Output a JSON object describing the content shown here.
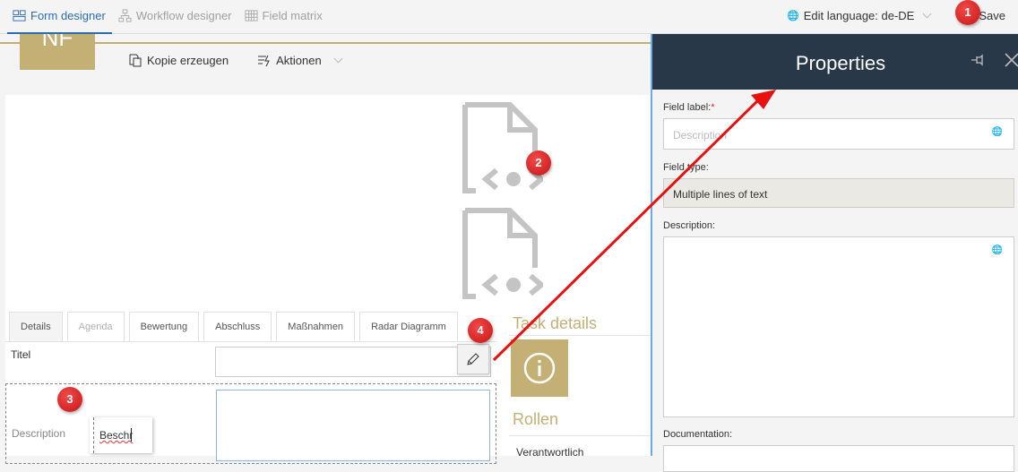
{
  "topbar": {
    "nav": [
      {
        "label": "Form designer",
        "icon": "form-icon",
        "active": true
      },
      {
        "label": "Workflow designer",
        "icon": "workflow-icon",
        "active": false
      },
      {
        "label": "Field matrix",
        "icon": "grid-icon",
        "active": false
      }
    ],
    "edit_language_label": "Edit language: de-DE",
    "save_label": "Save"
  },
  "form_header": {
    "logo_text": "NF",
    "commands": [
      {
        "label": "Kopie erzeugen",
        "icon": "copy-icon"
      },
      {
        "label": "Aktionen",
        "icon": "actions-icon"
      }
    ]
  },
  "form": {
    "tabs": [
      {
        "label": "Details",
        "active": true,
        "muted": false
      },
      {
        "label": "Agenda",
        "active": false,
        "muted": true
      },
      {
        "label": "Bewertung",
        "active": false,
        "muted": false
      },
      {
        "label": "Abschluss",
        "active": false,
        "muted": false
      },
      {
        "label": "Maßnahmen",
        "active": false,
        "muted": false
      },
      {
        "label": "Radar Diagramm",
        "active": false,
        "muted": false
      }
    ],
    "fields": {
      "titel_label": "Titel",
      "description_label": "Description",
      "inline_edit_value": "Beschr"
    },
    "side": {
      "task_details_heading": "Task details",
      "rollen_heading": "Rollen",
      "first_role": "Verantwortlich"
    }
  },
  "properties": {
    "title": "Properties",
    "field_label_label": "Field label:",
    "required_marker": "*",
    "field_label_placeholder": "Description",
    "field_type_label": "Field type:",
    "field_type_value": "Multiple lines of text",
    "description_label": "Description:",
    "documentation_label": "Documentation:"
  },
  "annotations": [
    "1",
    "2",
    "3",
    "4"
  ],
  "colors": {
    "accent_blue": "#2b6cb0",
    "gold": "#c4b074",
    "panel_header": "#283848",
    "annotation_red": "#e02020"
  }
}
